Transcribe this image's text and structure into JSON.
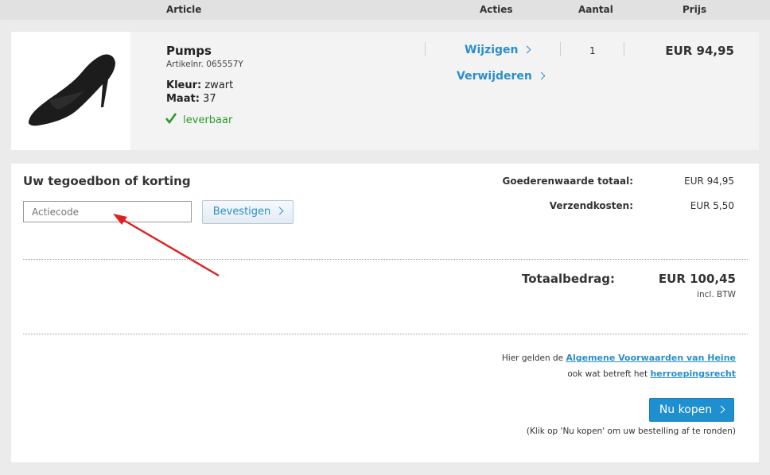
{
  "header": {
    "article": "Article",
    "acties": "Acties",
    "aantal": "Aantal",
    "prijs": "Prijs"
  },
  "item": {
    "name": "Pumps",
    "article_nr": "Artikelnr. 065557Y",
    "color_label": "Kleur:",
    "color_value": "zwart",
    "size_label": "Maat:",
    "size_value": "37",
    "availability": "leverbaar",
    "edit_label": "Wijzigen",
    "remove_label": "Verwijderen",
    "quantity": "1",
    "price": "EUR 94,95"
  },
  "coupon": {
    "title": "Uw tegoedbon of korting",
    "placeholder": "Actiecode",
    "confirm_label": "Bevestigen"
  },
  "summary": {
    "goods_label": "Goederenwaarde totaal:",
    "goods_value": "EUR 94,95",
    "shipping_label": "Verzendkosten:",
    "shipping_value": "EUR 5,50",
    "total_label": "Totaalbedrag:",
    "total_value": "EUR 100,45",
    "vat_note": "incl. BTW"
  },
  "terms": {
    "line1_prefix": "Hier gelden de",
    "terms_link": "Algemene Voorwaarden van Heine",
    "line2_prefix": "ook wat betreft het",
    "withdrawal_link": "herroepingsrecht"
  },
  "checkout": {
    "buy_label": "Nu kopen",
    "hint": "(Klik op 'Nu kopen' om uw bestelling af te ronden)"
  },
  "colors": {
    "accent": "#2b8fc9",
    "buy_button": "#1e8fcf",
    "available": "#2a9a2a",
    "arrow": "#e02020"
  }
}
